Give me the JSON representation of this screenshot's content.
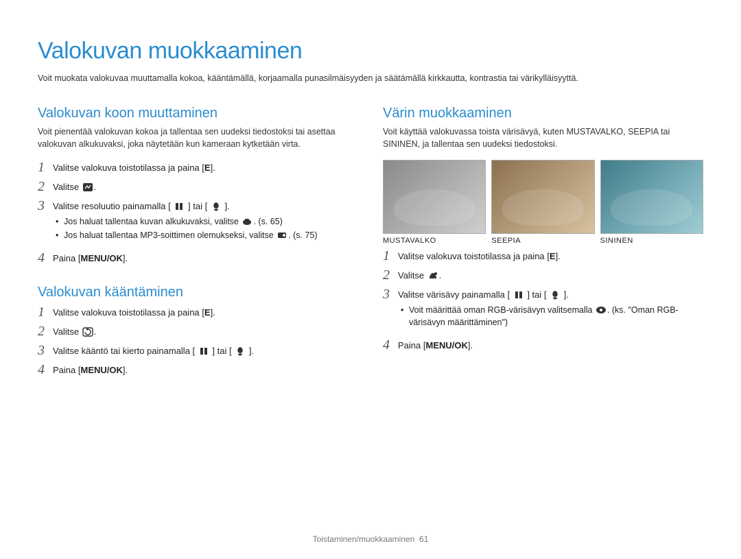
{
  "title": "Valokuvan muokkaaminen",
  "intro": "Voit muokata valokuvaa muuttamalla kokoa, kääntämällä, korjaamalla punasilmäisyyden ja säätämällä kirkkautta, kontrastia tai värikylläisyyttä.",
  "left": {
    "resize": {
      "title": "Valokuvan koon muuttaminen",
      "intro": "Voit pienentää valokuvan kokoa ja tallentaa sen uudeksi tiedostoksi tai asettaa valokuvan alkukuvaksi, joka näytetään kun kameraan kytketään virta.",
      "steps": {
        "s1_pre": "Valitse valokuva toistotilassa ja paina [",
        "s1_key": "E",
        "s1_post": "].",
        "s2": "Valitse ",
        "s3_a": "Valitse resoluutio painamalla [",
        "s3_b": "] tai [",
        "s3_c": "].",
        "sub1": "Jos haluat tallentaa kuvan alkukuvaksi, valitse ",
        "sub1_ref": ". (s. 65)",
        "sub2": "Jos haluat tallentaa MP3-soittimen olemukseksi, valitse ",
        "sub2_ref": ". (s. 75)",
        "s4_a": "Paina [",
        "s4_key": "MENU/OK",
        "s4_b": "]."
      }
    },
    "rotate": {
      "title": "Valokuvan kääntäminen",
      "steps": {
        "s1_pre": "Valitse valokuva toistotilassa ja paina [",
        "s1_key": "E",
        "s1_post": "].",
        "s2": "Valitse ",
        "s3_a": "Valitse kääntö tai kierto painamalla [",
        "s3_b": "] tai [",
        "s3_c": "].",
        "s4_a": "Paina [",
        "s4_key": "MENU/OK",
        "s4_b": "]."
      }
    }
  },
  "right": {
    "color": {
      "title": "Värin muokkaaminen",
      "intro": "Voit käyttää valokuvassa toista värisävyä, kuten MUSTAVALKO, SEEPIA tai SININEN, ja tallentaa sen uudeksi tiedostoksi.",
      "thumbs": {
        "bw": "MUSTAVALKO",
        "sepia": "SEEPIA",
        "blue": "SININEN"
      },
      "steps": {
        "s1_pre": "Valitse valokuva toistotilassa ja paina [",
        "s1_key": "E",
        "s1_post": "].",
        "s2": "Valitse ",
        "s3_a": "Valitse värisävy painamalla [",
        "s3_b": "] tai [",
        "s3_c": "].",
        "sub1a": "Voit määrittää oman RGB-värisävyn valitsemalla ",
        "sub1b": ". (ks. \"Oman RGB-värisävyn määrittäminen\")",
        "s4_a": "Paina [",
        "s4_key": "MENU/OK",
        "s4_b": "]."
      }
    }
  },
  "footer": {
    "section": "Toistaminen/muokkaaminen",
    "page": "61"
  }
}
